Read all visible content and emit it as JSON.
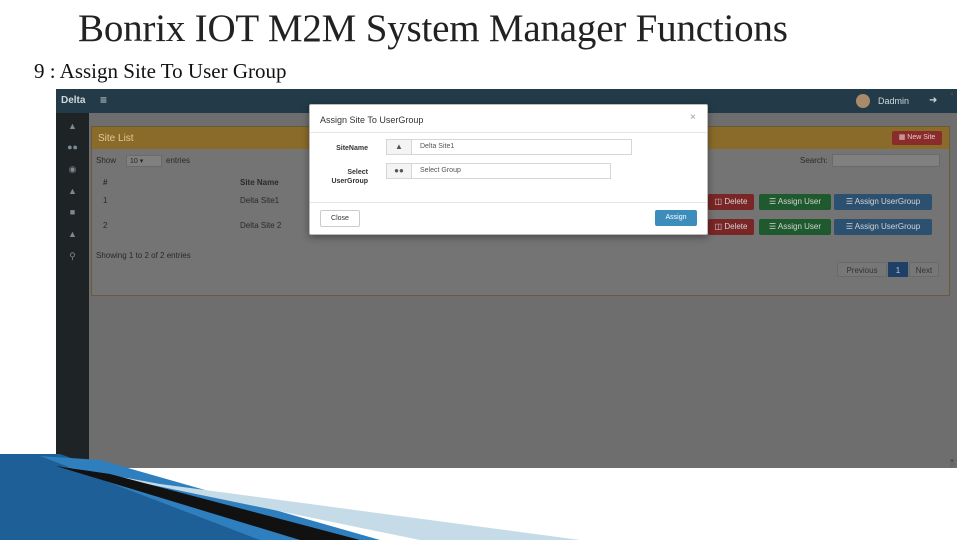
{
  "slide": {
    "title": "Bonrix IOT M2M System Manager Functions",
    "subtitle": "9 : Assign Site To User Group"
  },
  "app": {
    "brand": "Delta",
    "user": "Dadmin",
    "sidebar_icons": [
      "dashboard-icon",
      "devices-icon",
      "globe-icon",
      "sitemap-icon",
      "users-icon",
      "bell-icon",
      "wrench-icon"
    ],
    "panel_title": "Site List",
    "new_site_label": "New Site",
    "show_label": "Show",
    "entries_label": "entries",
    "page_length": "10",
    "search_label": "Search:",
    "table": {
      "columns": [
        "#",
        "Site Name"
      ],
      "rows": [
        {
          "num": "1",
          "name": "Delta Site1"
        },
        {
          "num": "2",
          "name": "Delta Site 2"
        }
      ]
    },
    "row_actions": {
      "delete": "Delete",
      "assign_user": "Assign User",
      "assign_usergroup": "Assign UserGroup"
    },
    "showing_text": "Showing 1 to 2 of 2 entries",
    "pagination": {
      "previous": "Previous",
      "current": "1",
      "next": "Next"
    }
  },
  "modal": {
    "title": "Assign Site To UserGroup",
    "close_symbol": "×",
    "sitename_label": "SiteName",
    "sitename_value": "Delta Site1",
    "usergroup_label_line1": "Select",
    "usergroup_label_line2": "UserGroup",
    "usergroup_placeholder": "Select Group",
    "close_button": "Close",
    "assign_button": "Assign"
  },
  "colors": {
    "modal_primary": "#3c8dbc",
    "topbar": "#233b48",
    "panel_header": "#8a6b2a"
  }
}
